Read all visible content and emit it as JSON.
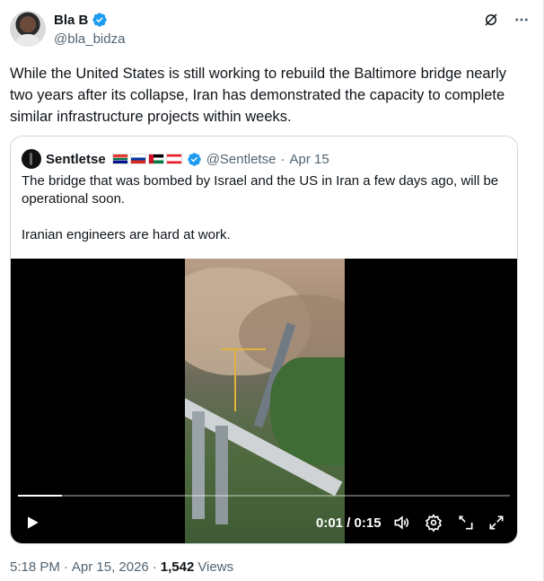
{
  "author": {
    "display_name": "Bla B",
    "handle": "@bla_bidza",
    "verified": true
  },
  "tweet_text": "While the United States is still working to rebuild the Baltimore bridge nearly two years after its collapse, Iran has demonstrated the capacity to complete similar infrastructure projects within weeks.",
  "quoted": {
    "display_name": "Sentletse",
    "flags": [
      "south-africa-flag",
      "russia-flag",
      "palestine-flag",
      "lebanon-flag"
    ],
    "handle": "@Sentletse",
    "separator": "·",
    "date": "Apr 15",
    "text_line1": "The bridge that was bombed by Israel and the US in Iran a few days ago, will be operational soon.",
    "text_line2": "Iranian engineers are hard at work."
  },
  "video": {
    "current_time": "0:01",
    "separator": " / ",
    "duration": "0:15",
    "progress_fraction": 0.09,
    "icons": [
      "play-icon",
      "volume-icon",
      "settings-icon",
      "minimize-icon",
      "fullscreen-icon"
    ]
  },
  "meta": {
    "time": "5:18 PM",
    "separator": "·",
    "date": "Apr 15, 2026",
    "separator2": "·",
    "views_count": "1,542",
    "views_label": "Views"
  },
  "colors": {
    "verified_blue": "#1d9bf0",
    "secondary_text": "#536471",
    "primary_text": "#0f1419"
  }
}
